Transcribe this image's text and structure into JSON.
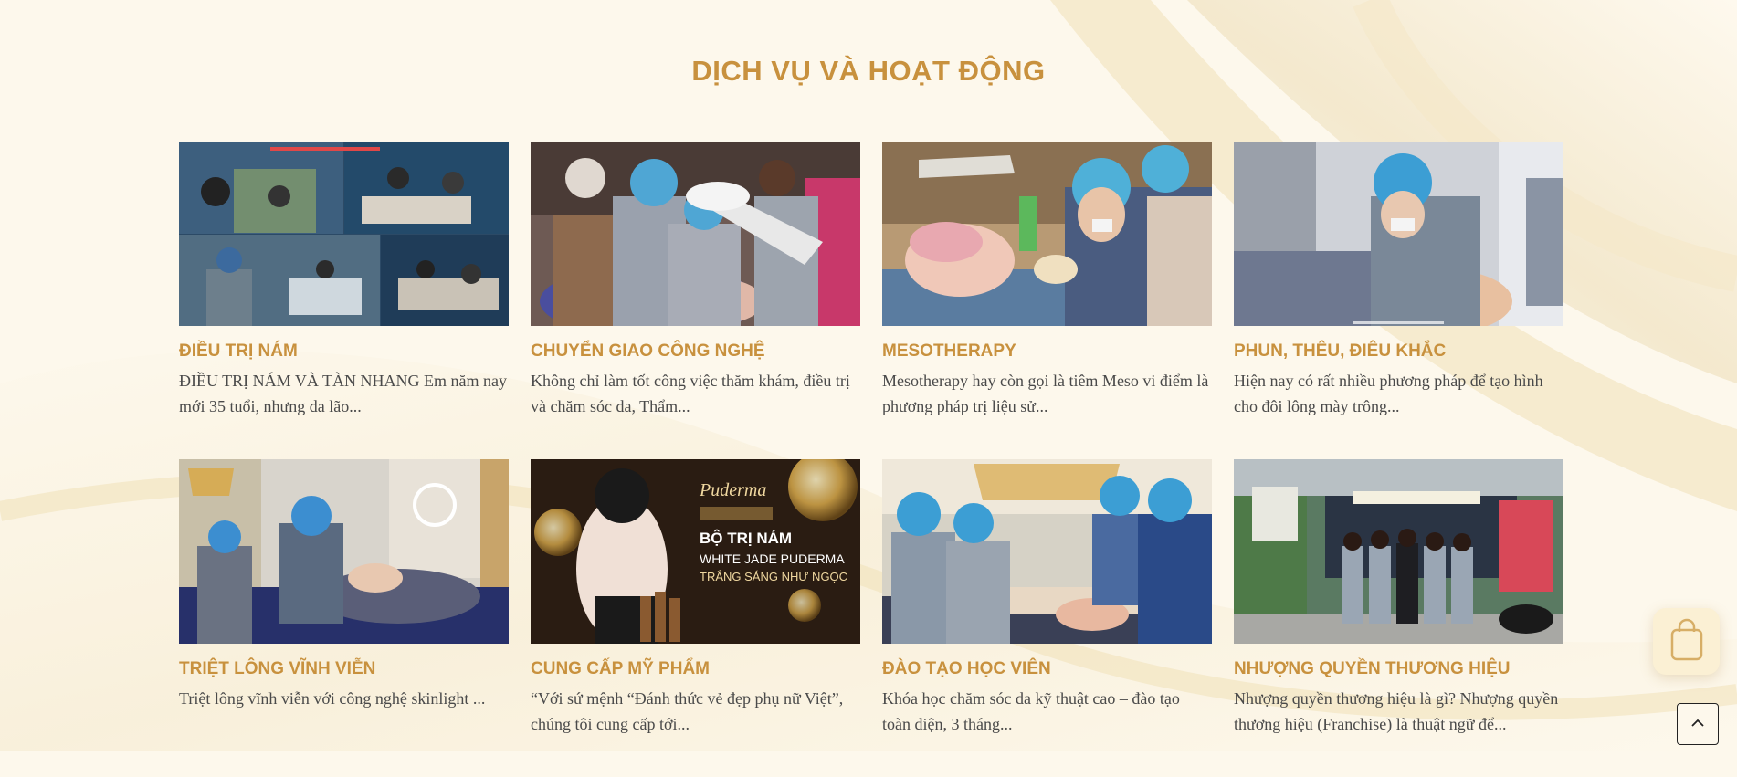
{
  "section": {
    "title": "DỊCH VỤ VÀ HOẠT ĐỘNG"
  },
  "cards": [
    {
      "title": "ĐIỀU TRỊ NÁM",
      "excerpt": "ĐIỀU TRỊ NÁM VÀ TÀN NHANG Em năm nay mới 35 tuổi, nhưng da lão...",
      "image_alt": "Treatment room collage"
    },
    {
      "title": "CHUYỂN GIAO CÔNG NGHỆ",
      "excerpt": "Không chỉ làm tốt công việc thăm khám, điều trị và chăm sóc da, Thẩm...",
      "image_alt": "Technicians working under lamp"
    },
    {
      "title": "MESOTHERAPY",
      "excerpt": "Mesotherapy hay còn gọi là tiêm Meso vi điểm là phương pháp trị liệu sử...",
      "image_alt": "Meso injection treatment"
    },
    {
      "title": "PHUN, THÊU, ĐIÊU KHẮC",
      "excerpt": "Hiện nay có rất nhiều phương pháp để tạo hình cho đôi lông mày trông...",
      "image_alt": "Eyebrow tattoo service"
    },
    {
      "title": "TRIỆT LÔNG VĨNH VIỄN",
      "excerpt": "Triệt lông vĩnh viễn với công nghệ skinlight ...",
      "image_alt": "Hair removal treatment"
    },
    {
      "title": "CUNG CẤP MỸ PHẨM",
      "excerpt": "“Với sứ mệnh “Đánh thức vẻ đẹp phụ nữ Việt”, chúng tôi cung cấp tới...",
      "image_alt": "Puderma product banner",
      "banner": {
        "brand": "Puderma",
        "line1": "BỘ TRỊ NÁM",
        "line2": "WHITE JADE PUDERMA",
        "line3": "TRẮNG SÁNG NHƯ NGỌC"
      }
    },
    {
      "title": "ĐÀO TẠO HỌC VIÊN",
      "excerpt": "Khóa học chăm sóc da kỹ thuật cao – đào tạo toàn diện, 3 tháng...",
      "image_alt": "Training class"
    },
    {
      "title": "NHƯỢNG QUYỀN THƯƠNG HIỆU",
      "excerpt": "Nhượng quyền thương hiệu là gì? Nhượng quyền thương hiệu (Franchise) là thuật ngữ để...",
      "image_alt": "Franchise storefront team"
    }
  ],
  "colors": {
    "accent": "#c8913e",
    "background": "#fdf8ec",
    "text": "#4a4a4a"
  },
  "icons": {
    "cart": "shopping-bag-icon",
    "back_to_top": "chevron-up-icon"
  }
}
